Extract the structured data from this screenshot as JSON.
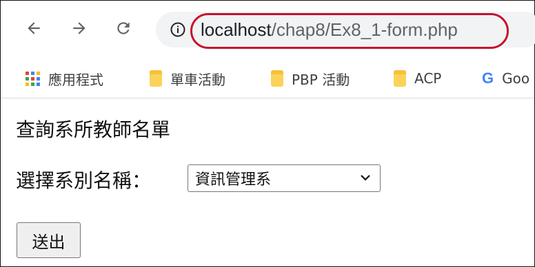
{
  "browser": {
    "url_host": "localhost",
    "url_path": "/chap8/Ex8_1-form.php",
    "bookmarks": [
      {
        "label": "應用程式",
        "icon": "apps-grid-icon"
      },
      {
        "label": "單車活動",
        "icon": "folder-icon"
      },
      {
        "label": "PBP 活動",
        "icon": "folder-icon"
      },
      {
        "label": "ACP",
        "icon": "folder-icon"
      },
      {
        "label": "Goo",
        "icon": "google-icon"
      }
    ]
  },
  "page": {
    "heading": "查詢系所教師名單",
    "dept_label": "選擇系別名稱：",
    "dept_selected": "資訊管理系",
    "submit_label": "送出"
  },
  "colors": {
    "highlight": "#c8102e",
    "folder": "#fbd35a"
  }
}
